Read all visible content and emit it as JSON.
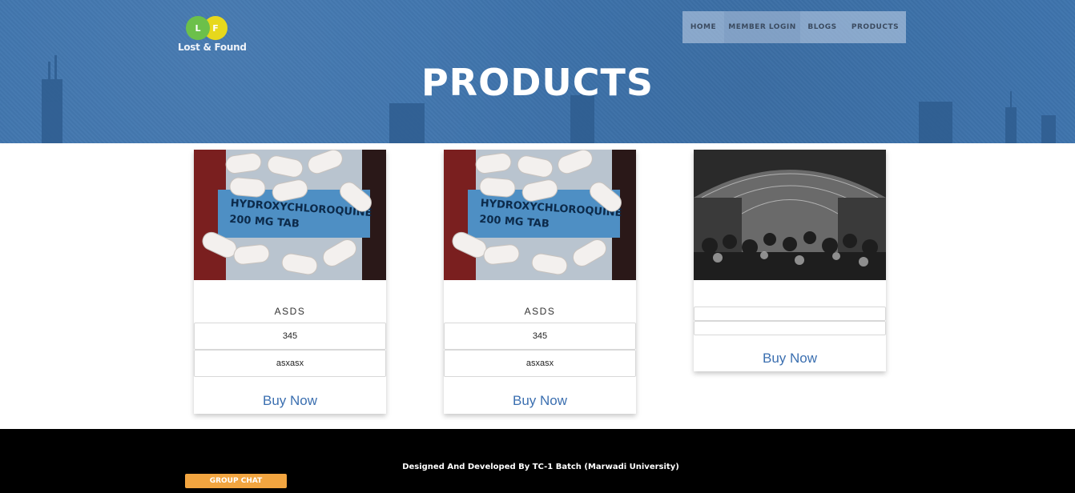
{
  "brand": {
    "logo_left_letter": "L",
    "logo_right_letter": "F",
    "logo_text": "Lost & Found",
    "colors": {
      "header_bg": "#3e74ad",
      "logo_green": "#6cc04a",
      "logo_yellow": "#e7d81d",
      "link_blue": "#3b6fb0",
      "chat_orange": "#f2a540"
    }
  },
  "nav": {
    "items": [
      {
        "label": "HOME"
      },
      {
        "label": "MEMBER LOGIN",
        "active": true
      },
      {
        "label": "BLOGS"
      },
      {
        "label": "PRODUCTS"
      }
    ]
  },
  "page": {
    "title": "PRODUCTS"
  },
  "products": [
    {
      "image": "hydroxychloroquine-pills-photo",
      "name": "ASDS",
      "price": "345",
      "description": "asxasx",
      "buy_label": "Buy Now"
    },
    {
      "image": "hydroxychloroquine-pills-photo",
      "name": "ASDS",
      "price": "345",
      "description": "asxasx",
      "buy_label": "Buy Now"
    },
    {
      "image": "crowded-market-bw-photo",
      "name": "",
      "price": "",
      "description": "",
      "buy_label": "Buy Now"
    }
  ],
  "footer": {
    "credit": "Designed And Developed By TC-1 Batch (Marwadi University)",
    "chat_button": "GROUP CHAT"
  }
}
